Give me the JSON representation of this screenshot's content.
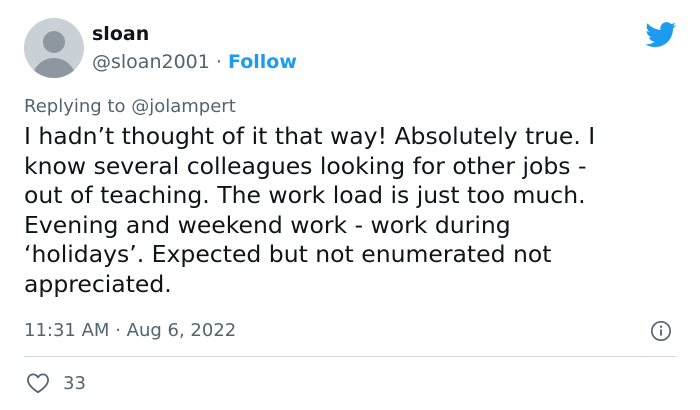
{
  "author": {
    "name": "sloan",
    "handle": "@sloan2001",
    "separator": "·",
    "follow_label": "Follow"
  },
  "reply": {
    "prefix": "Replying to",
    "mention": "@jolampert"
  },
  "tweet": {
    "lines": [
      "I hadn’t thought of it that way! Absolutely true. I",
      "know several colleagues looking for other jobs -",
      "out of teaching. The work load is just too much.",
      "Evening and weekend work - work during",
      "‘holidays’. Expected but not enumerated not",
      "appreciated."
    ]
  },
  "meta": {
    "time": "11:31 AM",
    "separator": "·",
    "date": "Aug 6, 2022"
  },
  "actions": {
    "likes": "33"
  },
  "icons": {
    "brand": "twitter-bird-icon",
    "info": "info-icon",
    "like": "heart-icon"
  },
  "colors": {
    "brand_blue": "#1d9bf0",
    "text_primary": "#0f1419",
    "text_secondary": "#536471",
    "divider": "#cfd9de"
  }
}
